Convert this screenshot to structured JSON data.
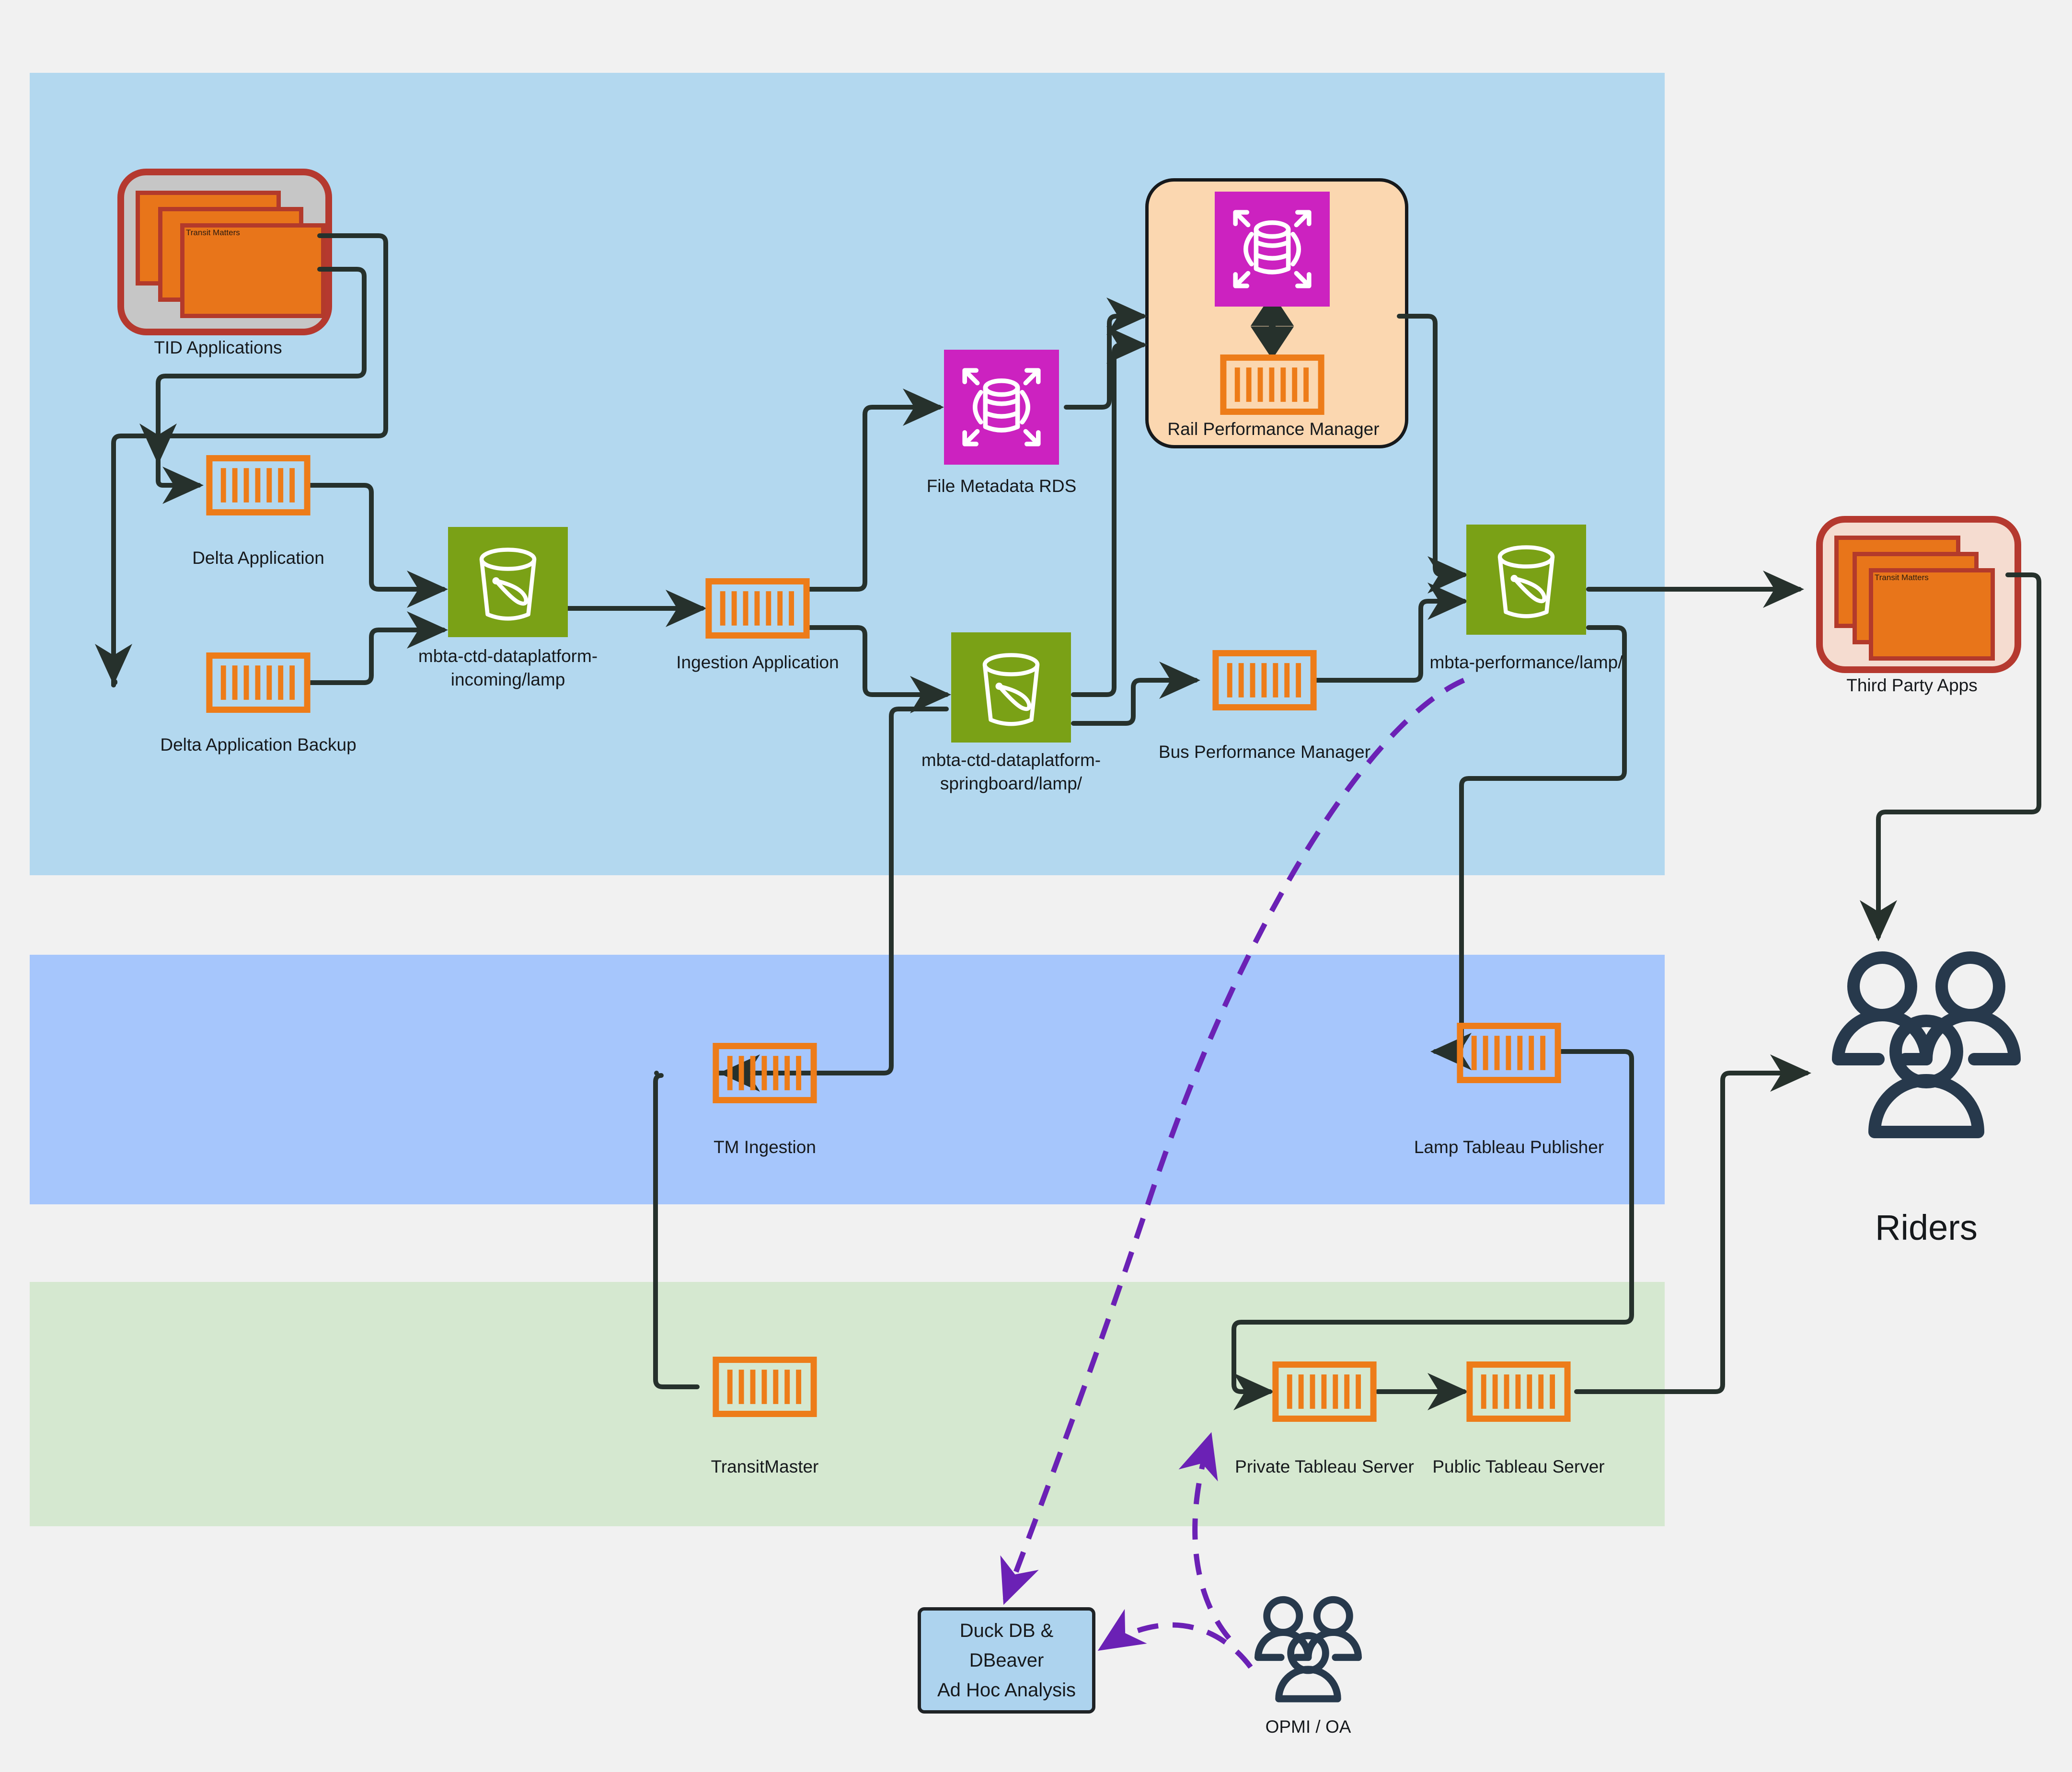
{
  "colors": {
    "page_bg": "#f1f1f1",
    "band_ingest": "#b3d8ef",
    "band_process": "#a6c6fc",
    "band_serve": "#d5e8d0",
    "aws_orange": "#ed7c19",
    "aws_green": "#7aa116",
    "aws_magenta": "#cc22c0",
    "group_red_border": "#b5392f",
    "group_grey_fill": "#c6c6c6",
    "group_pink_fill": "#f5dcd0",
    "group_peach_fill": "#fbd7b0",
    "group_peach_border": "#16191c",
    "edge": "#26312c",
    "edge_purple": "#6b21b5",
    "people": "#27394c",
    "window_fill": "#e8751a",
    "window_border": "#b33a2b",
    "duckdb_fill": "#add3ee",
    "duckdb_border": "#1f2326"
  },
  "bands": [
    {
      "name": "ingestion-band"
    },
    {
      "name": "processing-band"
    },
    {
      "name": "serving-band"
    }
  ],
  "groups": {
    "tid_applications": {
      "label": "TID Applications",
      "window_label": "Transit Matters"
    },
    "rail_performance_manager": {
      "label": "Rail Performance Manager"
    },
    "third_party_apps": {
      "label": "Third Party Apps",
      "window_label": "Transit Matters"
    }
  },
  "nodes": {
    "delta_application": {
      "label": "Delta Application",
      "icon": "container-icon"
    },
    "delta_application_backup": {
      "label": "Delta Application Backup",
      "icon": "container-icon"
    },
    "incoming_bucket": {
      "label": "mbta-ctd-dataplatform-\nincoming/lamp",
      "icon": "s3-bucket-icon"
    },
    "ingestion_application": {
      "label": "Ingestion Application",
      "icon": "container-icon"
    },
    "file_metadata_rds": {
      "label": "File Metadata RDS",
      "icon": "rds-icon"
    },
    "springboard_bucket": {
      "label": "mbta-ctd-dataplatform-\nspringboard/lamp/",
      "icon": "s3-bucket-icon"
    },
    "bus_performance_manager": {
      "label": "Bus Performance Manager",
      "icon": "container-icon"
    },
    "performance_bucket": {
      "label": "mbta-performance/lamp/",
      "icon": "s3-bucket-icon"
    },
    "tm_ingestion": {
      "label": "TM Ingestion",
      "icon": "container-icon"
    },
    "lamp_tableau_publisher": {
      "label": "Lamp Tableau Publisher",
      "icon": "container-icon"
    },
    "transitmaster": {
      "label": "TransitMaster",
      "icon": "container-icon"
    },
    "private_tableau_server": {
      "label": "Private Tableau Server",
      "icon": "container-icon"
    },
    "public_tableau_server": {
      "label": "Public Tableau Server",
      "icon": "container-icon"
    },
    "riders": {
      "label": "Riders",
      "icon": "people-group-icon"
    },
    "opmi_oa": {
      "label": "OPMI / OA",
      "icon": "people-group-icon"
    },
    "duckdb_dbeaver": {
      "label": "Duck DB &\nDBeaver\nAd Hoc Analysis",
      "icon": "analysis-box"
    }
  },
  "rail_pm_inner": {
    "rds": {
      "icon": "rds-icon"
    },
    "container": {
      "icon": "container-icon"
    }
  }
}
